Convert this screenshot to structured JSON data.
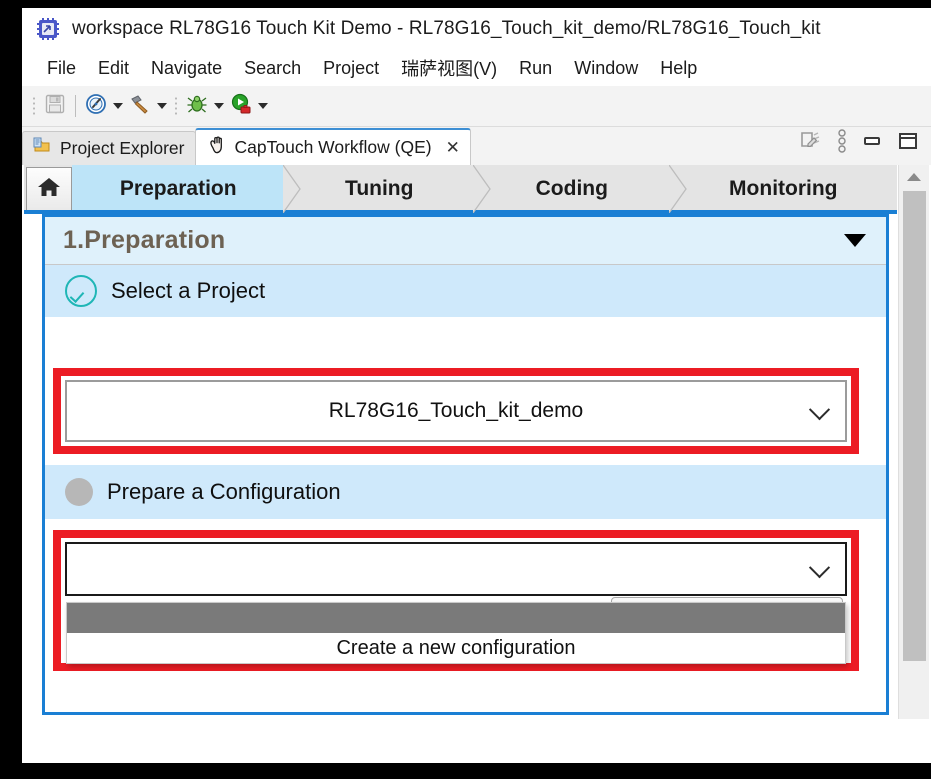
{
  "window": {
    "title": "workspace RL78G16 Touch Kit Demo - RL78G16_Touch_kit_demo/RL78G16_Touch_kit",
    "icon": "eclipse-workspace-icon"
  },
  "menubar": {
    "items": [
      {
        "label": "File"
      },
      {
        "label": "Edit"
      },
      {
        "label": "Navigate"
      },
      {
        "label": "Search"
      },
      {
        "label": "Project"
      },
      {
        "label": "瑞萨视图(V)"
      },
      {
        "label": "Run"
      },
      {
        "label": "Window"
      },
      {
        "label": "Help"
      }
    ]
  },
  "toolbar": {
    "items": [
      {
        "name": "save-button",
        "icon": "floppy-disk-icon"
      },
      {
        "name": "new-wizard-button",
        "icon": "compass-icon"
      },
      {
        "name": "build-button",
        "icon": "hammer-icon"
      },
      {
        "name": "debug-button",
        "icon": "bug-icon"
      },
      {
        "name": "run-button",
        "icon": "green-play-icon"
      }
    ]
  },
  "tabs": {
    "items": [
      {
        "label": "Project Explorer",
        "icon": "project-explorer-icon",
        "active": false,
        "closable": false
      },
      {
        "label": "CapTouch Workflow (QE)",
        "icon": "touch-hand-icon",
        "active": true,
        "closable": true,
        "close_label": "✕"
      }
    ],
    "view_actions": [
      {
        "name": "edit-pages-icon"
      },
      {
        "name": "view-menu-icon"
      },
      {
        "name": "minimize-icon"
      },
      {
        "name": "maximize-icon"
      }
    ]
  },
  "workflow": {
    "home_icon": "home-icon",
    "steps": [
      {
        "label": "Preparation",
        "current": true
      },
      {
        "label": "Tuning",
        "current": false
      },
      {
        "label": "Coding",
        "current": false
      },
      {
        "label": "Monitoring",
        "current": false
      }
    ]
  },
  "preparation": {
    "title": "1.Preparation",
    "collapse_icon": "chevron-down-icon",
    "sections": [
      {
        "label": "Select a Project",
        "status": "complete",
        "status_icon": "check-circle-icon",
        "field": {
          "value": "RL78G16_Touch_kit_demo",
          "placeholder": "",
          "dropdown_icon": "chevron-down-icon",
          "highlighted": true
        }
      },
      {
        "label": "Prepare a Configuration",
        "status": "pending",
        "status_icon": "gray-dot-icon",
        "field": {
          "value": "",
          "placeholder": "",
          "dropdown_icon": "chevron-down-icon",
          "highlighted": true,
          "expanded": true,
          "options": [
            {
              "label": "",
              "selected": true
            },
            {
              "label": "Create a new configuration",
              "selected": false
            }
          ]
        }
      }
    ]
  },
  "scrollbar": {
    "up_icon": "triangle-up-icon",
    "name": "vertical-scrollbar"
  },
  "colors": {
    "accent_blue": "#1a7fd4",
    "annotation_red": "#ec1c24",
    "step_current_bg": "#bde4f8",
    "panel_header_bg": "#dff1fb",
    "section_bg": "#cfe9fb",
    "check_teal": "#1fb6b6"
  }
}
